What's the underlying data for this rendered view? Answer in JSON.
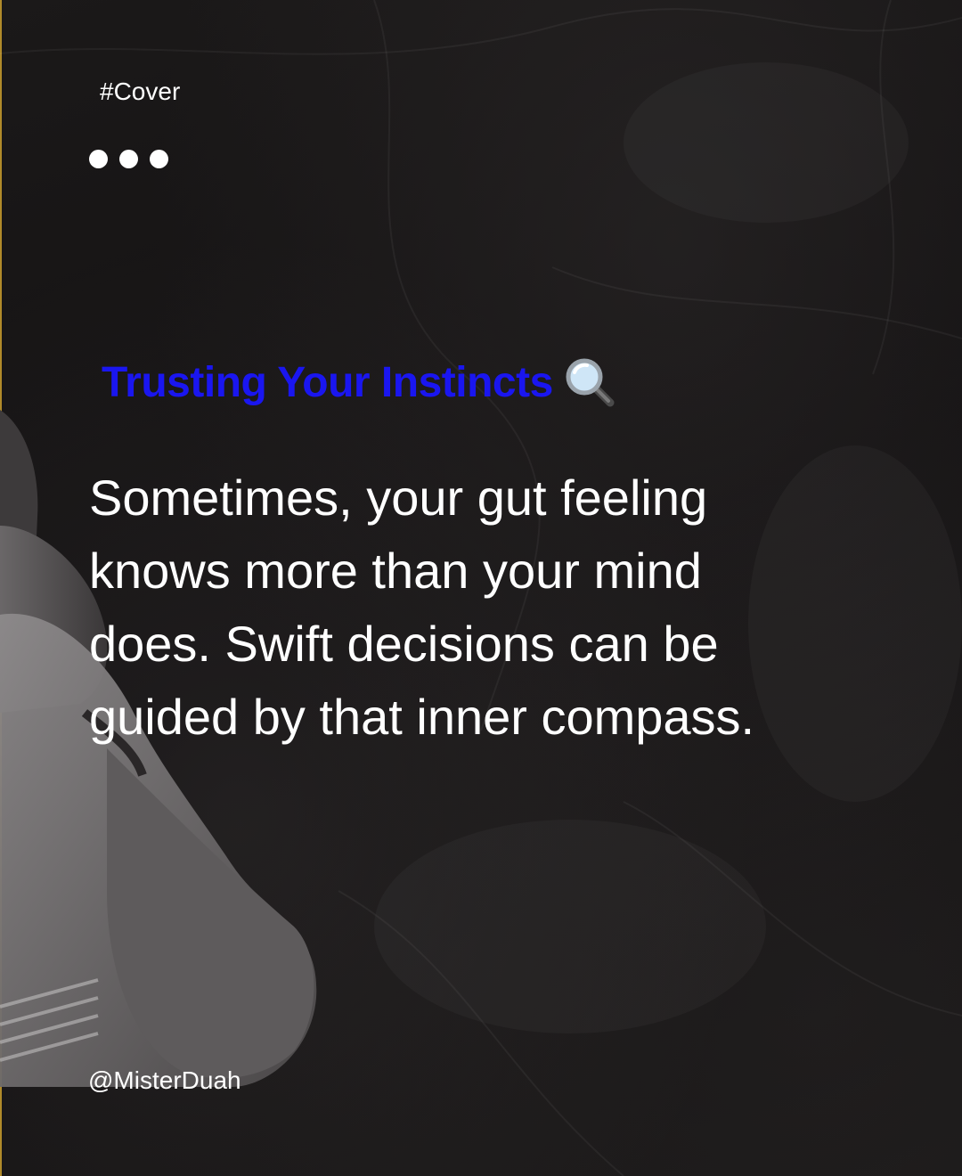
{
  "post": {
    "tag": "#Cover",
    "title": "Trusting Your Instincts",
    "title_icon": "magnifying-glass-icon",
    "body": "Sometimes, your gut feeling knows more than your mind does. Swift decisions can be guided by that inner compass.",
    "handle": "@MisterDuah"
  },
  "colors": {
    "background": "#141213",
    "title": "#1a16f0",
    "text": "#ffffff",
    "edge_accent": "#b08a2a"
  }
}
